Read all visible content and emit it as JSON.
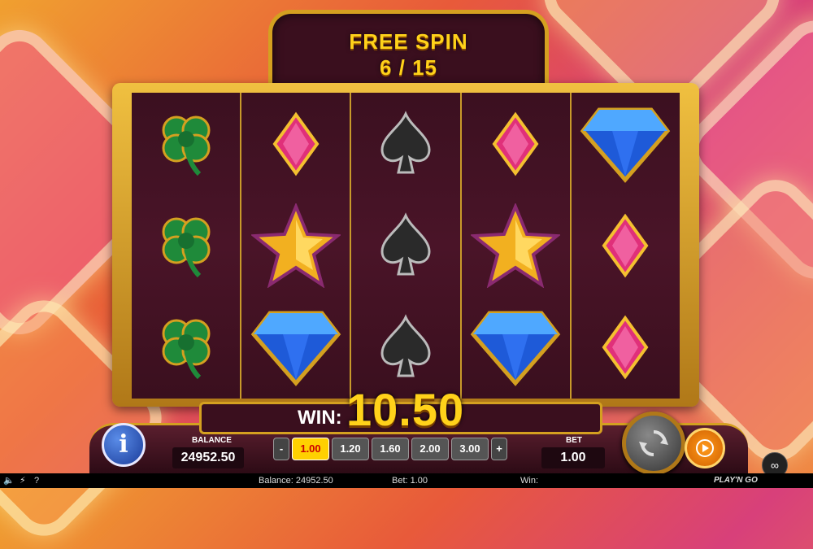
{
  "free_spin": {
    "title": "FREE SPIN",
    "count": "6 / 15"
  },
  "reels": [
    [
      "clover",
      "clover",
      "clover"
    ],
    [
      "pink-diamond",
      "gold-star",
      "blue-gem"
    ],
    [
      "spade",
      "spade",
      "spade"
    ],
    [
      "pink-diamond",
      "gold-star",
      "blue-gem"
    ],
    [
      "blue-gem",
      "pink-diamond",
      "pink-diamond"
    ]
  ],
  "win": {
    "label": "WIN:",
    "value": "10.50"
  },
  "balance": {
    "label": "BALANCE",
    "value": "24952.50"
  },
  "bet": {
    "label": "BET",
    "value": "1.00",
    "minus": "-",
    "plus": "+",
    "options": [
      "1.00",
      "1.20",
      "1.60",
      "2.00",
      "3.00"
    ],
    "selected": "1.00"
  },
  "info_button": "i",
  "status_bar": {
    "balance": "Balance: 24952.50",
    "bet": "Bet: 1.00",
    "win": "Win:",
    "help": "?"
  },
  "logo": "PLAY'N GO",
  "colors": {
    "gold": "#d4a020",
    "win_yellow": "#ffd21a",
    "reel_bg": "#3b1020",
    "selected_bet": "#ffd000"
  }
}
